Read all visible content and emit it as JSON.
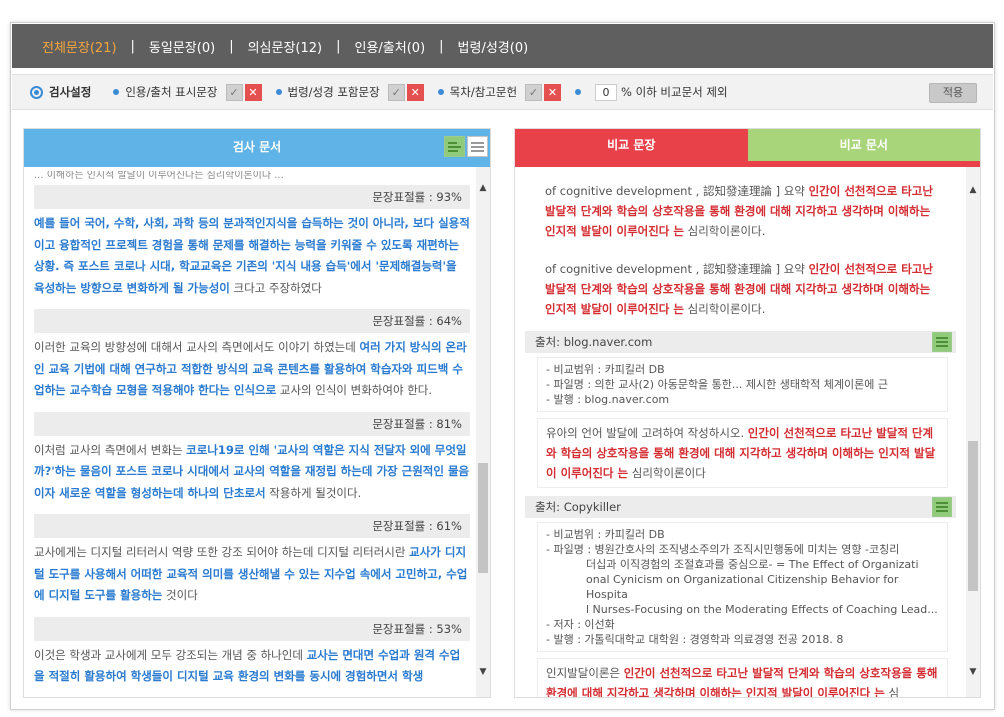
{
  "nav": {
    "tabs": [
      {
        "label": "전체문장(21)"
      },
      {
        "label": "동일문장(0)"
      },
      {
        "label": "의심문장(12)"
      },
      {
        "label": "인용/출처(0)"
      },
      {
        "label": "법령/성경(0)"
      }
    ],
    "separator": "|"
  },
  "settings": {
    "title": "검사설정",
    "opt1": "인용/출처 표시문장",
    "opt2": "법령/성경 포함문장",
    "opt3": "목차/참고문헌",
    "percent_value": "0",
    "percent_label": "% 이하 비교문서 제외",
    "apply_label": "적용",
    "check_glyph": "✓",
    "x_glyph": "✕"
  },
  "left": {
    "header": "검사 문서",
    "cut_text": "... 이해하는 인지적 발달이 이루어진다는 심리학이론이다 ...",
    "blocks": [
      {
        "ratio": "문장표절률 : 93%",
        "segments": [
          {
            "t": "예를 들어 국어, 수학, 사회, 과학 등의 분과적인지식을 습득하는 것이 아니라, 보다 실용적이고 융합적인 프로젝트 경험을 통해 문제를 해결하는 능력을 키워줄 수 있도록 재편하는 상황. 즉 포스트 코로나 시대, 학교교육은 기존의 '지식 내용 습득'에서 '문제해결능력'을 육성하는 방향으로 변화하게 될 가능성이",
            "h": true
          },
          {
            "t": " 크다고 주장하였다",
            "h": false
          }
        ]
      },
      {
        "ratio": "문장표절률 : 64%",
        "segments": [
          {
            "t": "이러한 교육의 방향성에 대해서 교사의 측면에서도 이야기 하였는데 ",
            "h": false
          },
          {
            "t": "여러 가지 방식의 온라인 교육 기법에 대해 연구하고 적합한 방식의 교육 콘텐츠를 활용하여 학습자와 피드백 수업하는 교수학습 모형을 적용해야 한다는 인식으로",
            "h": true
          },
          {
            "t": " 교사의 인식이 변화하여야 한다.",
            "h": false
          }
        ]
      },
      {
        "ratio": "문장표절률 : 81%",
        "segments": [
          {
            "t": "이처럼 교사의 측면에서 변화는 ",
            "h": false
          },
          {
            "t": "코로나19로 인해 '교사의 역할은 지식 전달자 외에 무엇일까?'하는 물음이 포스트 코로나 시대에서 교사의 역할을 재정립 하는데 가장 근원적인 물음이자 새로운 역할을 형성하는데 하나의 단초로서",
            "h": true
          },
          {
            "t": " 작용하게 될것이다.",
            "h": false
          }
        ]
      },
      {
        "ratio": "문장표절률 : 61%",
        "segments": [
          {
            "t": "교사에게는 디지털 리터러시 역량 또한 강조 되어야 하는데 디지털 리터러시란 ",
            "h": false
          },
          {
            "t": "교사가 디지털 도구를 사용해서 어떠한 교육적 의미를 생산해낼 수 있는 지수업 속에서 고민하고, 수업에 디지털 도구를 활용하는",
            "h": true
          },
          {
            "t": " 것이다",
            "h": false
          }
        ]
      },
      {
        "ratio": "문장표절률 : 53%",
        "segments": [
          {
            "t": "이것은 학생과 교사에게 모두 강조되는 개념 중 하나인데 ",
            "h": false
          },
          {
            "t": "교사는 면대면 수업과 원격 수업을 적절히 활용하여 학생들이 디지털 교육 환경의 변화를 동시에 경험하면서 학생",
            "h": true
          }
        ]
      }
    ]
  },
  "right": {
    "tab1": "비교 문장",
    "tab2": "비교 문서",
    "items": [
      {
        "pre": "of cognitive development , 認知發達理論 ] 요약 ",
        "hl": "인간이 선천적으로 타고난 발달적 단계와 학습의 상호작용을 통해 환경에 대해 지각하고 생각하며 이해하는 인지적 발달이 이루어진다 는",
        "post": " 심리학이론이다."
      },
      {
        "pre": "of cognitive development , 認知發達理論 ] 요약 ",
        "hl": "인간이 선천적으로 타고난 발달적 단계와 학습의 상호작용을 통해 환경에 대해 지각하고 생각하며 이해하는 인지적 발달이 이루어진다 는",
        "post": " 심리학이론이다."
      }
    ],
    "sources": [
      {
        "head": "출처: blog.naver.com",
        "meta": [
          {
            "t": "- 비교범위 : 카피킬러 DB",
            "indent": false
          },
          {
            "t": "- 파일명 : 의한 교사(2) 아동문학을 통한... 제시한 생태학적 체계이론에 근",
            "indent": false
          },
          {
            "t": "- 발행 : blog.naver.com",
            "indent": false
          }
        ],
        "pre": "유아의 언어 발달에 고려하여 작성하시오. ",
        "hl": "인간이 선천적으로 타고난 발달적 단계와 학습의 상호작용을 통해 환경에 대해 지각하고 생각하며 이해하는 인지적 발달이 이루어진다 는",
        "post": " 심리학이론이다"
      },
      {
        "head": "출처: Copykiller",
        "meta": [
          {
            "t": "- 비교범위 : 카피킬러 DB",
            "indent": false
          },
          {
            "t": "- 파일명 : 병원간호사의 조직냉소주의가 조직시민행동에 미치는 영향 -코칭리",
            "indent": false
          },
          {
            "t": "더십과 이직경험의 조절효과를 중심으로- = The Effect of Organizati",
            "indent": true
          },
          {
            "t": "onal Cynicism on Organizational Citizenship Behavior for Hospita",
            "indent": true
          },
          {
            "t": "l Nurses-Focusing on the Moderating Effects of Coaching Lead...",
            "indent": true
          },
          {
            "t": "- 저자 : 이선화",
            "indent": false
          },
          {
            "t": "- 발행 : 가톨릭대학교 대학원 : 경영학과 의료경영 전공 2018. 8",
            "indent": false
          }
        ],
        "pre": "인지발달이론은 ",
        "hl": "인간이 선천적으로 타고난 발달적 단계와 학습의 상호작용을 통해 환경에 대해 지각하고 생각하며 이해하는 인지적 발달이 이루어진다 는",
        "post": " 심"
      }
    ]
  },
  "scroll": {
    "up": "▲",
    "down": "▼"
  },
  "colors": {
    "nav_bg": "#5f5f5f",
    "nav_active": "#f5a53c",
    "left_header": "#5fb3e6",
    "right_tab1": "#e8414a",
    "right_tab2": "#a9d57a",
    "left_highlight": "#2a7bd0",
    "right_highlight": "#d42d32"
  }
}
